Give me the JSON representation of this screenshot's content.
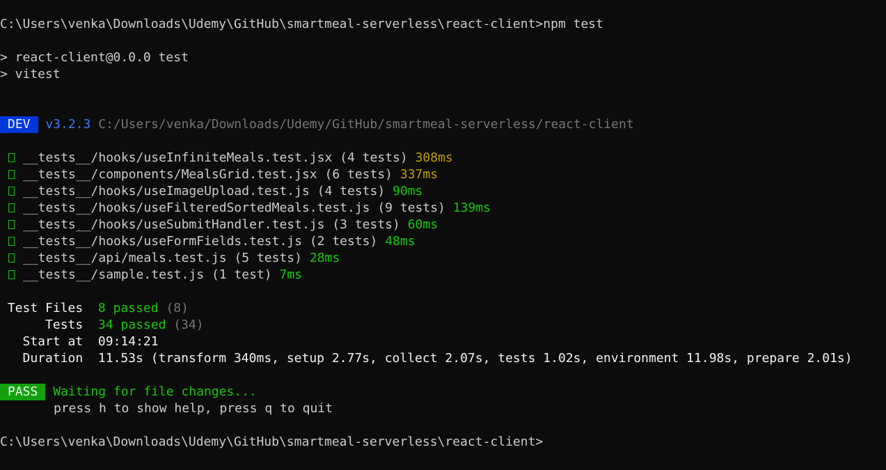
{
  "prompt": {
    "path": "C:\\Users\\venka\\Downloads\\Udemy\\GitHub\\smartmeal-serverless\\react-client>",
    "command": "npm test"
  },
  "script_lines": [
    "> react-client@0.0.0 test",
    "> vitest"
  ],
  "dev_header": {
    "badge": "DEV",
    "version": "v3.2.3",
    "path": "C:/Users/venka/Downloads/Udemy/GitHub/smartmeal-serverless/react-client"
  },
  "test_results": [
    {
      "file": "__tests__/hooks/useInfiniteMeals.test.jsx",
      "count": "(4 tests)",
      "time": "308ms",
      "time_color": "yellow"
    },
    {
      "file": "__tests__/components/MealsGrid.test.jsx",
      "count": "(6 tests)",
      "time": "337ms",
      "time_color": "yellow"
    },
    {
      "file": "__tests__/hooks/useImageUpload.test.js",
      "count": "(4 tests)",
      "time": "90ms",
      "time_color": "green"
    },
    {
      "file": "__tests__/hooks/useFilteredSortedMeals.test.js",
      "count": "(9 tests)",
      "time": "139ms",
      "time_color": "green"
    },
    {
      "file": "__tests__/hooks/useSubmitHandler.test.js",
      "count": "(3 tests)",
      "time": "60ms",
      "time_color": "green"
    },
    {
      "file": "__tests__/hooks/useFormFields.test.js",
      "count": "(2 tests)",
      "time": "48ms",
      "time_color": "green"
    },
    {
      "file": "__tests__/api/meals.test.js",
      "count": "(5 tests)",
      "time": "28ms",
      "time_color": "green"
    },
    {
      "file": "__tests__/sample.test.js",
      "count": "(1 test)",
      "time": "7ms",
      "time_color": "green"
    }
  ],
  "summary": {
    "test_files_label": " Test Files",
    "test_files_passed": "8 passed",
    "test_files_total": "(8)",
    "tests_label": "      Tests",
    "tests_passed": "34 passed",
    "tests_total": "(34)",
    "start_label": "   Start at",
    "start_value": "09:14:21",
    "duration_label": "   Duration",
    "duration_value": "11.53s (transform 340ms, setup 2.77s, collect 2.07s, tests 1.02s, environment 11.98s, prepare 2.01s)"
  },
  "watch": {
    "badge": "PASS",
    "message": "Waiting for file changes...",
    "help": "press h to show help, press q to quit"
  },
  "final_prompt": "C:\\Users\\venka\\Downloads\\Udemy\\GitHub\\smartmeal-serverless\\react-client>",
  "colors": {
    "background": "#0c0c0c",
    "text": "#cccccc",
    "green": "#16c60c",
    "yellow": "#c19c00",
    "blue": "#3b78ff",
    "gray": "#767676",
    "dev_badge": "#0037da",
    "pass_badge": "#13a10e"
  }
}
